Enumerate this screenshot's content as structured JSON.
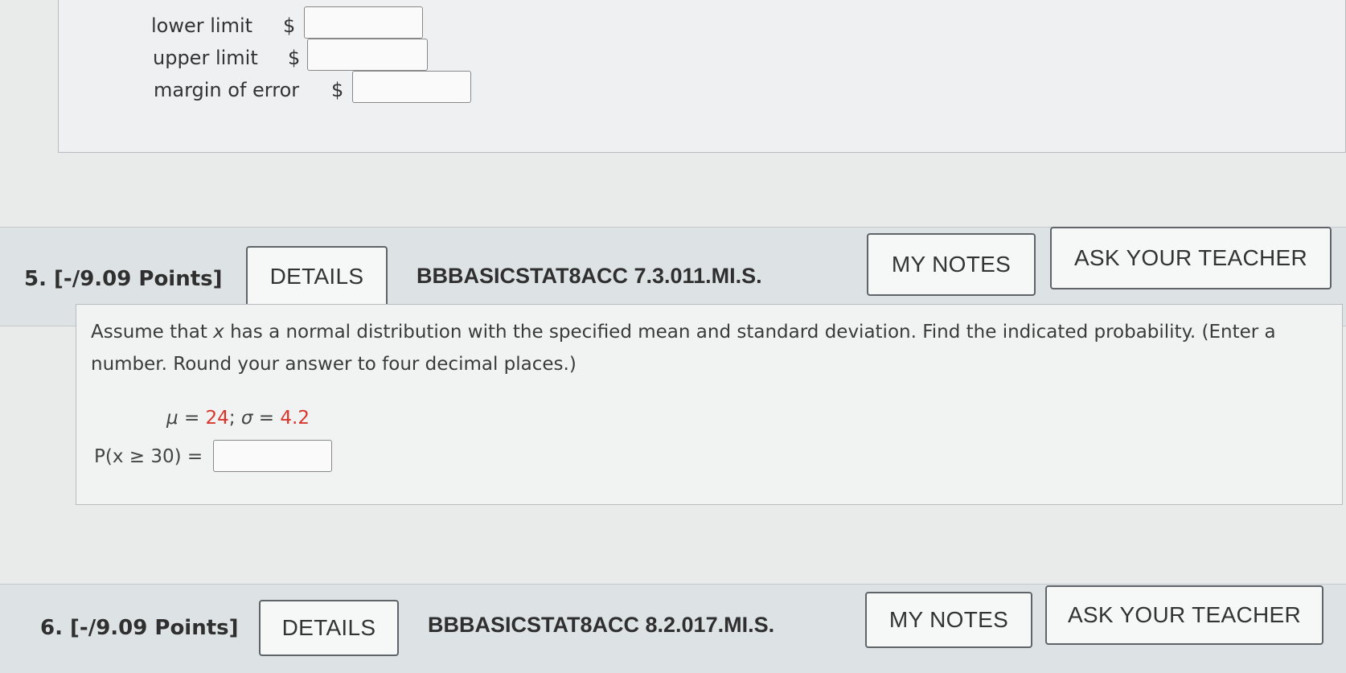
{
  "prev_question": {
    "rows": [
      {
        "label": "lower limit",
        "currency": "$",
        "value": ""
      },
      {
        "label": "upper limit",
        "currency": "$",
        "value": ""
      },
      {
        "label": "margin of error",
        "currency": "$",
        "value": ""
      }
    ]
  },
  "question5": {
    "number": "5. [-/9.09 Points]",
    "details_label": "DETAILS",
    "code": "BBBASICSTAT8ACC 7.3.011.MI.S.",
    "my_notes_label": "MY NOTES",
    "ask_teacher_label": "ASK YOUR TEACHER",
    "text_part1": "Assume that ",
    "text_var": "x",
    "text_part2": " has a normal distribution with the specified mean and standard deviation. Find the indicated probability. (Enter a number. Round your answer to four decimal places.)",
    "mu_symbol": "μ",
    "mu_eq": " = ",
    "mu_value": "24",
    "sep": "; ",
    "sigma_symbol": "σ",
    "sigma_eq": " = ",
    "sigma_value": "4.2",
    "prob_label": "P(x ≥ 30)  =",
    "answer_value": ""
  },
  "question6": {
    "number": "6. [-/9.09 Points]",
    "details_label": "DETAILS",
    "code": "BBBASICSTAT8ACC 8.2.017.MI.S.",
    "my_notes_label": "MY NOTES",
    "ask_teacher_label": "ASK YOUR TEACHER"
  },
  "colors": {
    "param_value": "#d8352c",
    "header_bg": "#dde2e4",
    "page_bg": "#e9eaea"
  }
}
